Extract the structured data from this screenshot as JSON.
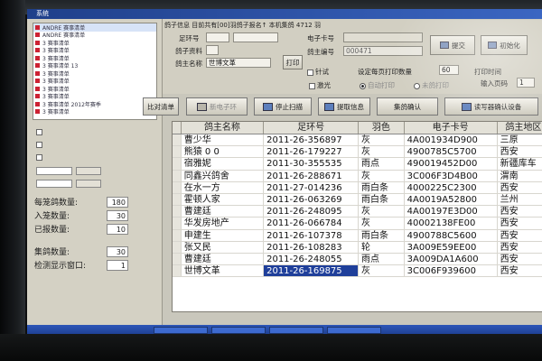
{
  "window": {
    "title": "系统"
  },
  "sidebar": {
    "tree_items": [
      "ANDRE 赛事清单",
      "ANDRE 赛事清单",
      "3 赛事清单",
      "3 赛事清单",
      "3 赛事清单",
      "3 赛事清单 13",
      "3 赛事清单",
      "3 赛事清单",
      "3 赛事清单",
      "3 赛事清单",
      "3 赛事清单 2012年赛季",
      "3 赛事清单"
    ],
    "stats": [
      {
        "label": "每笼鸽数量:",
        "value": "180"
      },
      {
        "label": "入笼数量:",
        "value": "30"
      },
      {
        "label": "已报数量:",
        "value": "10"
      },
      {
        "label": "集鸽数量:",
        "value": "30"
      },
      {
        "label": "检测显示窗口:",
        "value": "1"
      }
    ]
  },
  "form": {
    "header": "鸽子信息  目前共有[00]羽鸽子报名↑  本机集鸽 4712 羽",
    "ring_label": "足环号",
    "ring_value": "",
    "pigeon_label": "鸽子资料",
    "owner_label": "鸽主名称",
    "owner_value": "世博文革",
    "print_button": "打印",
    "card_label": "电子卡号",
    "card_value": "",
    "owner_no_label": "鸽主编号",
    "owner_no_value": "000471",
    "count_label": "针试",
    "page_label": "设定每页打印数量",
    "page_value": "60",
    "print_time_label": "打印时间",
    "input_label": "输入页码",
    "input_value": "1",
    "radio_labels": [
      "激光",
      "自动打印",
      "未鸽打印"
    ],
    "top_buttons": [
      "提交",
      "初始化"
    ]
  },
  "toolbar": {
    "buttons": [
      "比对清单",
      "新电子环",
      "停止扫描",
      "提取信息",
      "集鸽确认",
      "读写器确认设备"
    ]
  },
  "table": {
    "headers": [
      "鸽主名称",
      "足环号",
      "羽色",
      "电子卡号",
      "鸽主地区"
    ],
    "rows": [
      [
        "曹少华",
        "2011-26-356897",
        "灰",
        "4A001934D900",
        "三原"
      ],
      [
        "熊猿 0 0",
        "2011-26-179227",
        "灰",
        "4900785C5700",
        "西安"
      ],
      [
        "宿雅妮",
        "2011-30-355535",
        "雨点",
        "490019452D00",
        "新疆库车"
      ],
      [
        "同鑫兴鸽舍",
        "2011-26-288671",
        "灰",
        "3C006F3D4B00",
        "渭南"
      ],
      [
        "在水一方",
        "2011-27-014236",
        "雨白条",
        "4000225C2300",
        "西安"
      ],
      [
        "霍顿人家",
        "2011-26-063269",
        "雨白条",
        "4A0019A52800",
        "兰州"
      ],
      [
        "曹建廷",
        "2011-26-248095",
        "灰",
        "4A00197E3D00",
        "西安"
      ],
      [
        "华发房地产",
        "2011-26-066784",
        "灰",
        "40002138FE00",
        "西安"
      ],
      [
        "申建生",
        "2011-26-107378",
        "雨白条",
        "4900788C5600",
        "西安"
      ],
      [
        "张又民",
        "2011-26-108283",
        "轮",
        "3A009E59EE00",
        "西安"
      ],
      [
        "曹建廷",
        "2011-26-248055",
        "雨点",
        "3A009DA1A600",
        "西安"
      ],
      [
        "世博文革",
        "2011-26-169875",
        "灰",
        "3C006F939600",
        "西安"
      ]
    ]
  },
  "taskbar": {
    "items": [
      "",
      "",
      "",
      ""
    ]
  }
}
